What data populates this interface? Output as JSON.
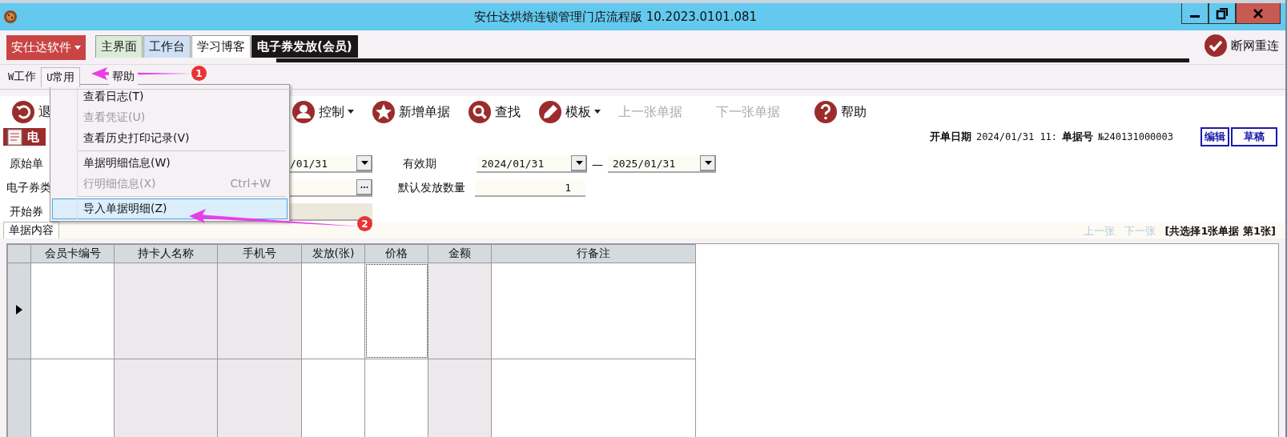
{
  "window": {
    "title": "安仕达烘焙连锁管理门店流程版   10.2023.0101.081"
  },
  "brand_button": {
    "label": "安仕达软件"
  },
  "tabs": [
    {
      "label": "主界面",
      "color": "#dcebd8",
      "selected": false
    },
    {
      "label": "工作台",
      "color": "#cfe0f5",
      "selected": false
    },
    {
      "label": "学习博客",
      "color": "#ffffff",
      "selected": false
    },
    {
      "label": "电子券发放(会员)",
      "color": "#1a1718",
      "selected": true
    }
  ],
  "reconnect_button": {
    "label": "断网重连"
  },
  "menu_bar": [
    {
      "key": "W",
      "label": "工作",
      "open": false
    },
    {
      "key": "U",
      "label": "常用",
      "open": true
    },
    {
      "label": "帮助",
      "open": false
    }
  ],
  "toolbar": [
    {
      "kind": "back",
      "label": "退",
      "disabled": false
    },
    {
      "kind": "user",
      "label": "控制",
      "dropdown": true,
      "disabled": false
    },
    {
      "kind": "star",
      "label": "新增单据",
      "dropdown": false,
      "disabled": false
    },
    {
      "kind": "search",
      "label": "查找",
      "dropdown": false,
      "disabled": false
    },
    {
      "kind": "pencil",
      "label": "模板",
      "dropdown": true,
      "disabled": false
    },
    {
      "kind": "none",
      "label": "上一张单据",
      "dropdown": false,
      "disabled": true
    },
    {
      "kind": "none",
      "label": "下一张单据",
      "dropdown": false,
      "disabled": true
    },
    {
      "kind": "help",
      "label": "帮助",
      "dropdown": false,
      "disabled": false
    }
  ],
  "doc_title": "电",
  "doc_info": {
    "date_label": "开单日期",
    "date": "2024/01/31 11:",
    "number_label": "单据号",
    "number": "№240131000003",
    "buttons": [
      "编辑",
      "草稿"
    ]
  },
  "form": [
    {
      "label": "原始单",
      "value": "/01/31",
      "kind": "date",
      "label2": "有效期",
      "value2": "2024/01/31",
      "value3": "2025/01/31",
      "dash": "—"
    },
    {
      "label": "电子券类",
      "kind": "browse",
      "label2": "默认发放数量",
      "value2": "1"
    },
    {
      "label": "开始券",
      "kind": "readonly"
    }
  ],
  "detail_tabs": [
    {
      "label": "单据内容",
      "selected": true
    }
  ],
  "pager": {
    "prev": "上一张",
    "next": "下一张",
    "summary": "[共选择1张单据  第1张]"
  },
  "table": {
    "columns": [
      "会员卡编号",
      "持卡人名称",
      "手机号",
      "发放(张)",
      "价格",
      "金额",
      "行备注"
    ],
    "rows": [
      {
        "current": true
      }
    ]
  },
  "menu": [
    {
      "kind": "item",
      "label": "查看日志(T)",
      "disabled": false,
      "highlighted": false
    },
    {
      "kind": "item",
      "label": "查看凭证(U)",
      "disabled": true,
      "highlighted": false
    },
    {
      "kind": "item",
      "label": "查看历史打印记录(V)",
      "disabled": false,
      "highlighted": false
    },
    {
      "kind": "separator"
    },
    {
      "kind": "item",
      "label": "单据明细信息(W)",
      "disabled": false,
      "highlighted": false
    },
    {
      "kind": "item",
      "label": "行明细信息(X)",
      "shortcut": "Ctrl+W",
      "disabled": true,
      "highlighted": false
    },
    {
      "kind": "separator"
    },
    {
      "kind": "item",
      "label": "导入单据明细(Z)",
      "disabled": false,
      "highlighted": true
    }
  ],
  "annotations": [
    "1",
    "2"
  ]
}
